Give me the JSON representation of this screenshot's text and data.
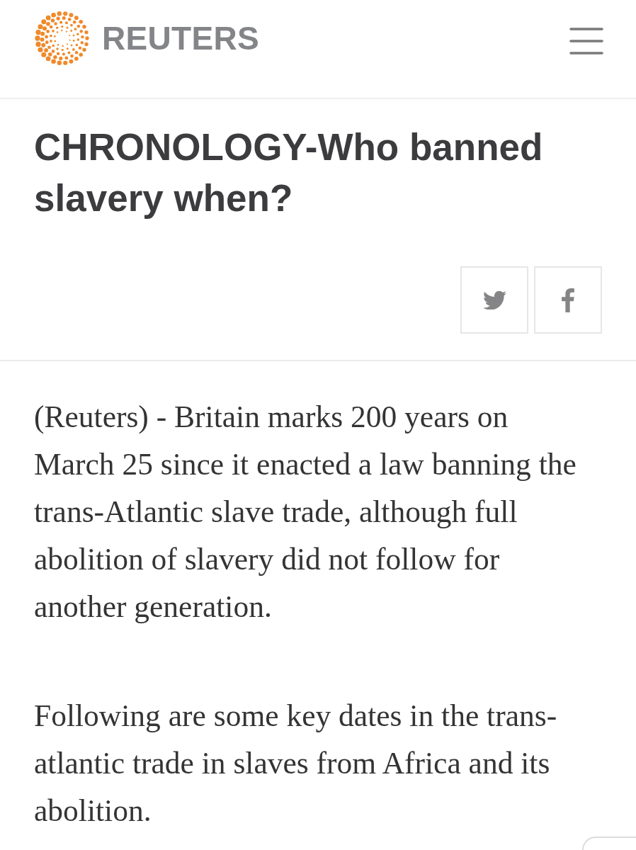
{
  "header": {
    "wordmark": "REUTERS"
  },
  "headline": "CHRONOLOGY-Who banned slavery when?",
  "share_buttons": [
    {
      "kind": "twitter"
    },
    {
      "kind": "facebook"
    }
  ],
  "article": {
    "paragraphs": [
      "(Reuters) - Britain marks 200 years on March 25 since it enacted a law banning the trans-Atlantic slave trade, although full abolition of slavery did not follow for another generation.",
      "Following are some key dates in the trans-atlantic trade in slaves from Africa and its abolition."
    ]
  }
}
